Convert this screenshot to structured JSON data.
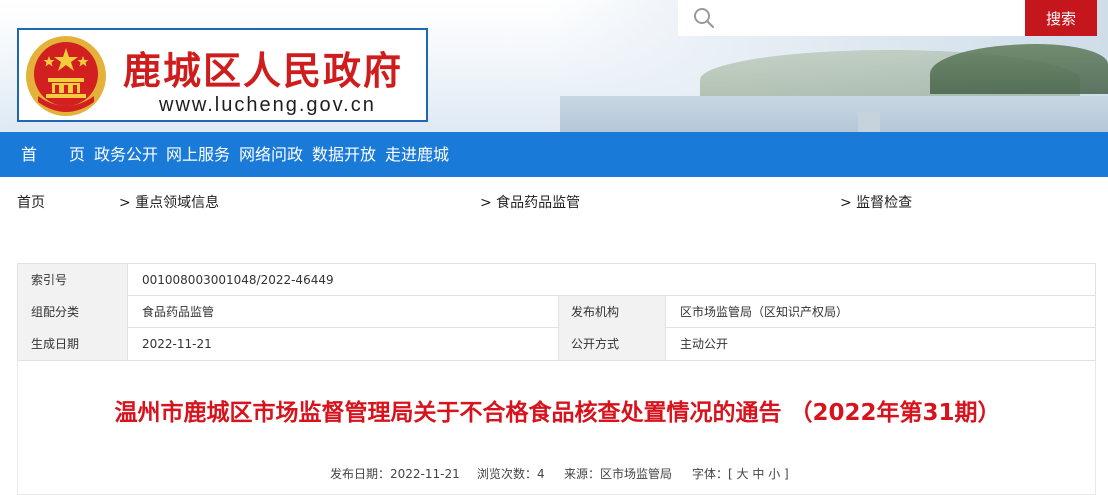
{
  "header": {
    "site_name": "鹿城区人民政府",
    "site_url": "www.lucheng.gov.cn"
  },
  "search": {
    "placeholder": "",
    "button_label": "搜索"
  },
  "nav": {
    "items": [
      "首　　页",
      "政务公开",
      "网上服务",
      "网络问政",
      "数据开放",
      "走进鹿城"
    ]
  },
  "breadcrumb": {
    "items": [
      "首页",
      "> 重点领域信息",
      "> 食品药品监管",
      "> 监督检查"
    ]
  },
  "info": {
    "index_label": "索引号",
    "index_value": "001008003001048/2022-46449",
    "category_label": "组配分类",
    "category_value": "食品药品监管",
    "publisher_label": "发布机构",
    "publisher_value": "区市场监管局（区知识产权局）",
    "date_label": "生成日期",
    "date_value": "2022-11-21",
    "mode_label": "公开方式",
    "mode_value": "主动公开"
  },
  "article": {
    "title": "温州市鹿城区市场监督管理局关于不合格食品核查处置情况的通告 （2022年第31期）",
    "meta": {
      "publish_date": "发布日期：2022-11-21",
      "views": "浏览次数：4",
      "source": "来源：区市场监管局",
      "font_label": "字体：[",
      "font_large": "大",
      "font_medium": "中",
      "font_small": "小",
      "font_end": "]"
    }
  },
  "colors": {
    "nav_bg": "#1a7ad8",
    "title_red": "#d7141d",
    "search_btn": "#c4161c",
    "site_name_red": "#cf1d1d"
  },
  "icons": [
    "national-emblem-icon",
    "search-icon"
  ]
}
